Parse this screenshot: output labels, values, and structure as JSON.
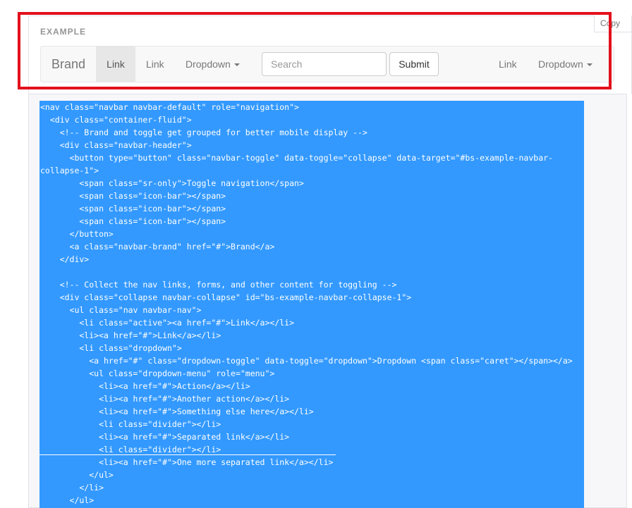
{
  "example": {
    "label": "EXAMPLE",
    "copy_label": "Copy"
  },
  "navbar": {
    "brand": "Brand",
    "link_active": "Link",
    "link_2": "Link",
    "dropdown_1": "Dropdown",
    "search_placeholder": "Search",
    "submit_label": "Submit",
    "link_right": "Link",
    "dropdown_right": "Dropdown"
  },
  "colors": {
    "highlight_border": "#e3101c",
    "selection": "#3399ff"
  },
  "code_lines": [
    "<nav class=\"navbar navbar-default\" role=\"navigation\">",
    "  <div class=\"container-fluid\">",
    "    <!-- Brand and toggle get grouped for better mobile display -->",
    "    <div class=\"navbar-header\">",
    "      <button type=\"button\" class=\"navbar-toggle\" data-toggle=\"collapse\" data-target=\"#bs-example-navbar-",
    "collapse-1\">",
    "        <span class=\"sr-only\">Toggle navigation</span>",
    "        <span class=\"icon-bar\"></span>",
    "        <span class=\"icon-bar\"></span>",
    "        <span class=\"icon-bar\"></span>",
    "      </button>",
    "      <a class=\"navbar-brand\" href=\"#\">Brand</a>",
    "    </div>",
    "",
    "    <!-- Collect the nav links, forms, and other content for toggling -->",
    "    <div class=\"collapse navbar-collapse\" id=\"bs-example-navbar-collapse-1\">",
    "      <ul class=\"nav navbar-nav\">",
    "        <li class=\"active\"><a href=\"#\">Link</a></li>",
    "        <li><a href=\"#\">Link</a></li>",
    "        <li class=\"dropdown\">",
    "          <a href=\"#\" class=\"dropdown-toggle\" data-toggle=\"dropdown\">Dropdown <span class=\"caret\"></span></a>",
    "          <ul class=\"dropdown-menu\" role=\"menu\">",
    "            <li><a href=\"#\">Action</a></li>",
    "            <li><a href=\"#\">Another action</a></li>",
    "            <li><a href=\"#\">Something else here</a></li>",
    "            <li class=\"divider\"></li>",
    "            <li><a href=\"#\">Separated link</a></li>",
    "            <li class=\"divider\"></li>",
    "            <li><a href=\"#\">One more separated link</a></li>",
    "          </ul>",
    "        </li>",
    "      </ul>"
  ]
}
